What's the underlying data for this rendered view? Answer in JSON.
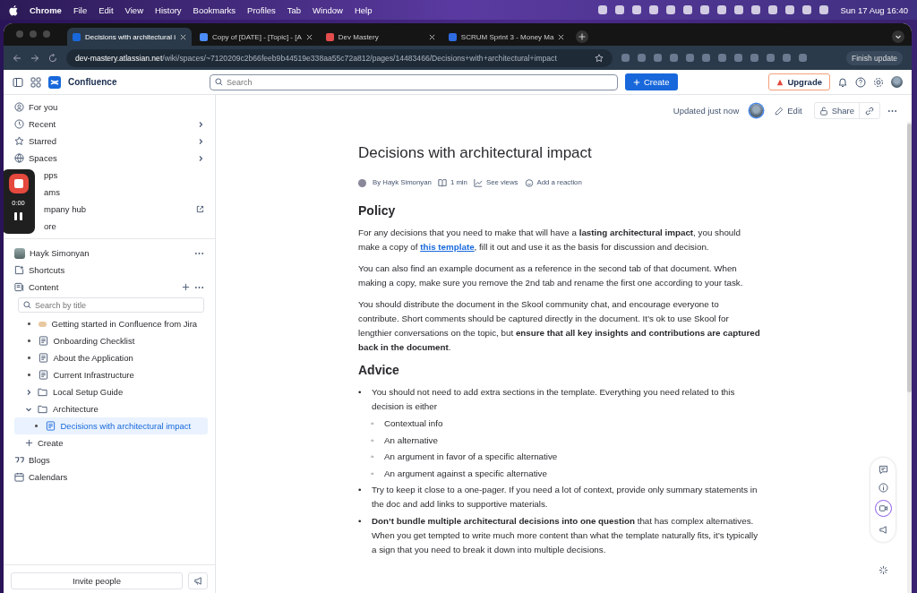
{
  "menubar": {
    "app": "Chrome",
    "items": [
      "File",
      "Edit",
      "View",
      "History",
      "Bookmarks",
      "Profiles",
      "Tab",
      "Window",
      "Help"
    ],
    "clock": "Sun 17 Aug  16:40"
  },
  "tabs": [
    {
      "title": "Decisions with architectural i",
      "selected": true
    },
    {
      "title": "Copy of [DATE] - [Topic] - [A",
      "selected": false
    },
    {
      "title": "Dev Mastery",
      "selected": false
    },
    {
      "title": "SCRUM Sprint 3 - Money Ma",
      "selected": false
    }
  ],
  "address": {
    "host": "dev-mastery.atlassian.net",
    "path": "/wiki/spaces/~7120209c2b66feeb9b44519e338aa55c72a812/pages/14483466/Decisions+with+architectural+impact",
    "update": "Finish update"
  },
  "topnav": {
    "product": "Confluence",
    "search_placeholder": "Search",
    "create": "Create",
    "upgrade": "Upgrade"
  },
  "sidebar": {
    "nav": [
      {
        "label": "For you",
        "kind": "user",
        "chevron": false,
        "external": false
      },
      {
        "label": "Recent",
        "kind": "clock",
        "chevron": true,
        "external": false
      },
      {
        "label": "Starred",
        "kind": "star",
        "chevron": true,
        "external": false
      },
      {
        "label": "Spaces",
        "kind": "globe",
        "chevron": true,
        "external": false
      },
      {
        "label": "pps",
        "kind": "none",
        "chevron": false,
        "external": false
      },
      {
        "label": "ams",
        "kind": "none",
        "chevron": false,
        "external": false
      },
      {
        "label": "mpany hub",
        "kind": "none",
        "chevron": false,
        "external": true
      },
      {
        "label": "ore",
        "kind": "none",
        "chevron": false,
        "external": false
      }
    ],
    "recorder": {
      "time": "0:00"
    },
    "space": {
      "name": "Hayk Simonyan",
      "shortcuts": "Shortcuts",
      "content": "Content",
      "search_placeholder": "Search by title"
    },
    "tree": [
      {
        "label": "Getting started in Confluence from Jira",
        "kind": "emoji",
        "selected": false
      },
      {
        "label": "Onboarding Checklist",
        "kind": "page",
        "selected": false
      },
      {
        "label": "About the Application",
        "kind": "page",
        "selected": false
      },
      {
        "label": "Current Infrastructure",
        "kind": "page",
        "selected": false
      },
      {
        "label": "Local Setup Guide",
        "kind": "folder",
        "selected": false,
        "expanded": false
      },
      {
        "label": "Architecture",
        "kind": "folder",
        "selected": false,
        "expanded": true,
        "children": [
          {
            "label": "Decisions with architectural impact",
            "kind": "page",
            "selected": true
          }
        ]
      }
    ],
    "create": "Create",
    "extra": [
      {
        "label": "Blogs",
        "kind": "quote"
      },
      {
        "label": "Calendars",
        "kind": "calendar"
      }
    ],
    "invite": "Invite people"
  },
  "page": {
    "updated": "Updated just now",
    "edit": "Edit",
    "share": "Share",
    "title": "Decisions with architectural impact",
    "byline": {
      "author": "By Hayk Simonyan",
      "read": "1 min",
      "views": "See views",
      "reaction": "Add a reaction"
    },
    "sections": [
      {
        "heading": "Policy",
        "blocks": [
          {
            "kind": "para",
            "parts": [
              {
                "kind": "text",
                "text": "For any decisions that you need to make that will have a **lasting architectural impact**, you should make a copy of "
              },
              {
                "kind": "link",
                "text": "this template"
              },
              {
                "kind": "text",
                "text": ", fill it out and use it as the basis for discussion and decision."
              }
            ]
          },
          {
            "kind": "para",
            "parts": [
              {
                "kind": "text",
                "text": "You can also find an example document as a reference in the second tab of that document. When making a copy, make sure you remove the 2nd tab and rename the first one according to your task."
              }
            ]
          },
          {
            "kind": "para",
            "parts": [
              {
                "kind": "text",
                "text": "You should distribute the document in the Skool community chat, and encourage everyone to contribute. Short comments should be captured directly in the document. It’s ok to use Skool for lengthier conversations on the topic, but **ensure that all key insights and contributions are captured back in the document**."
              }
            ]
          }
        ]
      },
      {
        "heading": "Advice",
        "blocks": [
          {
            "kind": "list",
            "items": [
              {
                "marker": "•",
                "text": "You should not need to add extra sections in the template. Everything you need related to this decision is either",
                "children": [
                  {
                    "marker": "◦",
                    "text": "Contextual info"
                  },
                  {
                    "marker": "◦",
                    "text": "An alternative"
                  },
                  {
                    "marker": "◦",
                    "text": "An argument in favor of a specific alternative"
                  },
                  {
                    "marker": "◦",
                    "text": "An argument against a specific alternative"
                  }
                ]
              },
              {
                "marker": "•",
                "text": "Try to keep it close to a one-pager. If you need a lot of context, provide only summary statements in the doc and add links to supportive materials."
              },
              {
                "marker": "•",
                "text": "**Don’t bundle multiple architectural decisions into one question** that has complex alternatives. When you get tempted to write much more content than what the template naturally fits, it’s typically a sign that you need to break it down into multiple decisions."
              }
            ]
          }
        ]
      }
    ]
  }
}
